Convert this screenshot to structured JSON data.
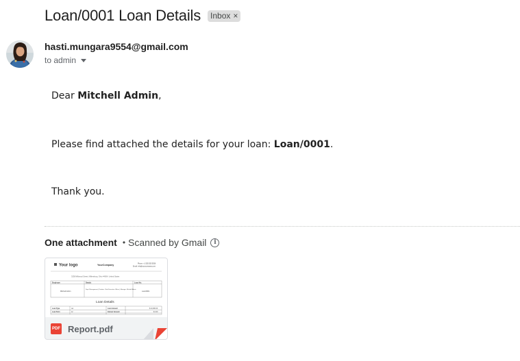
{
  "email": {
    "subject": "Loan/0001 Loan Details",
    "label": "Inbox",
    "label_close": "×",
    "sender": "hasti.mungara9554@gmail.com",
    "recipient": "to admin"
  },
  "body": {
    "greeting_prefix": "Dear ",
    "greeting_name": "Mitchell Admin",
    "greeting_suffix": ",",
    "line_prefix": "Please find attached the details for your loan: ",
    "loan_ref": "Loan/0001",
    "line_suffix": ".",
    "closing": "Thank you."
  },
  "attachments": {
    "count_label": "One attachment",
    "separator": "•",
    "scan_status": "Scanned by Gmail",
    "info_glyph": "i",
    "file": {
      "name": "Report.pdf",
      "type_badge": "PDF",
      "type_color": "#ea4335"
    },
    "preview": {
      "logo": "Your logo",
      "company": "YourCompany",
      "phone": "Phone: +1 555 555 5556",
      "email": "Email: info@yourcompany.com",
      "address": "3238 Millwood Street, Millersburg, Ohio 44654, United States",
      "col_employee": "Employee",
      "col_details": "Details",
      "col_loan_no": "Loan No:",
      "employee": "Mitchell Admin",
      "details": "Dept: Management | Position: Chief Executive Officer | Manager: Mitchell Admin",
      "loan_no": "Loan/0001",
      "section_title": "Loan Details",
      "row1": [
        "Loan Type",
        "car",
        "Loan Amount",
        "$ 10,000.00"
      ],
      "row2": [
        "Loan Term",
        "12",
        "Interest Amount",
        "$ 0.00"
      ]
    }
  }
}
